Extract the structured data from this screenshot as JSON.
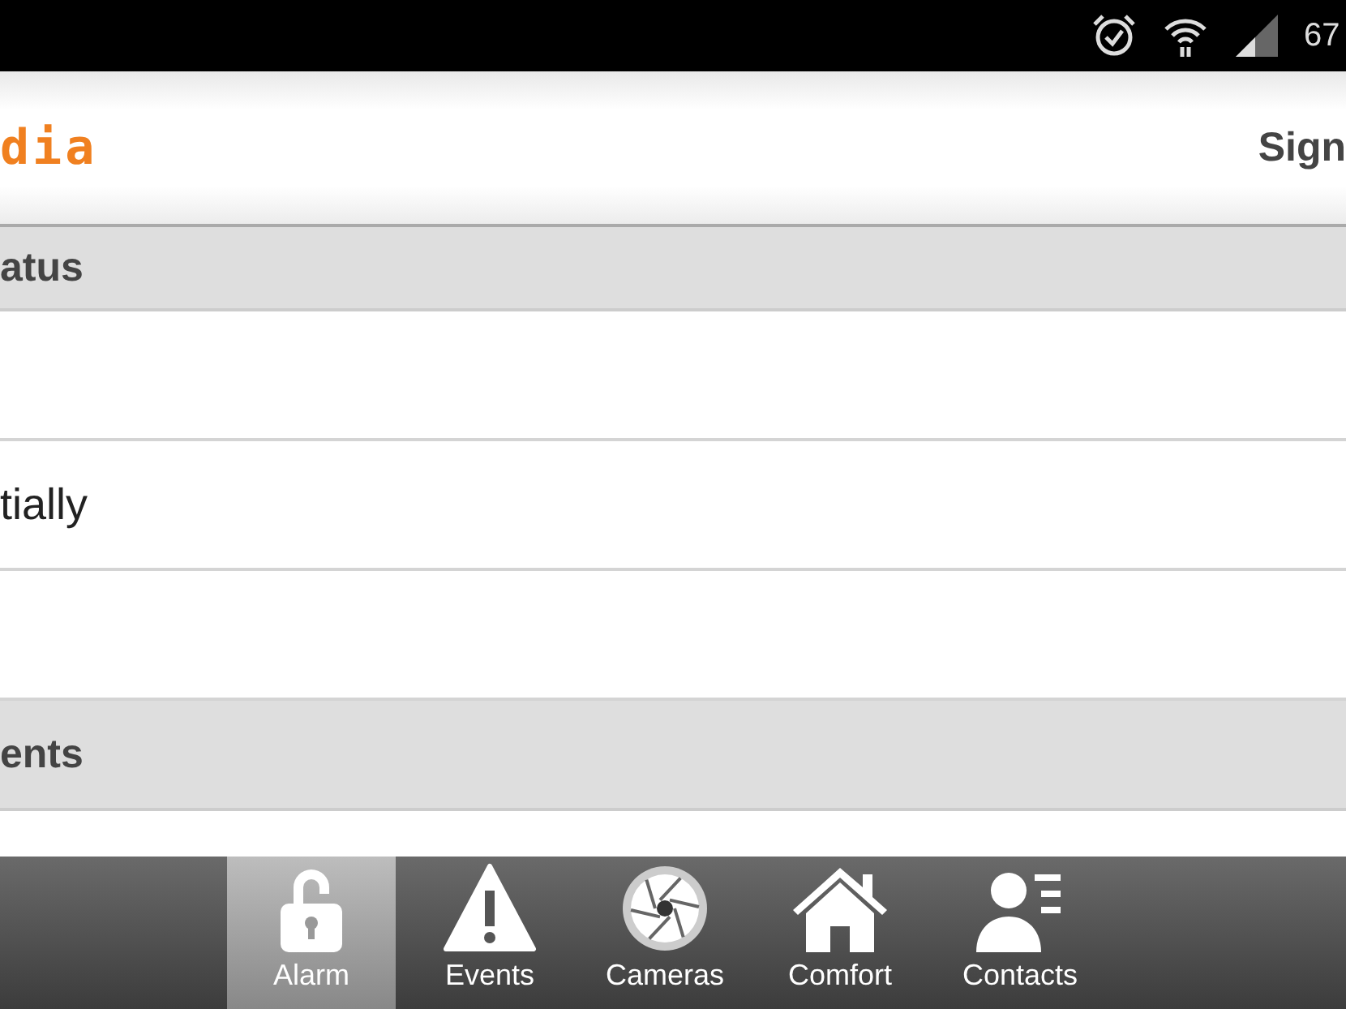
{
  "status_bar": {
    "battery_text": "67"
  },
  "header": {
    "logo": "dia",
    "action": "Sign"
  },
  "sections": [
    {
      "title": "atus",
      "rows": [
        {},
        {
          "text": "tially"
        },
        {}
      ]
    },
    {
      "title": "ents"
    }
  ],
  "tabs": [
    {
      "label": "Alarm",
      "kind": "lock",
      "selected": true
    },
    {
      "label": "Events",
      "kind": "warning",
      "selected": false
    },
    {
      "label": "Cameras",
      "kind": "aperture",
      "selected": false
    },
    {
      "label": "Comfort",
      "kind": "home",
      "selected": false
    },
    {
      "label": "Contacts",
      "kind": "contact",
      "selected": false
    }
  ]
}
